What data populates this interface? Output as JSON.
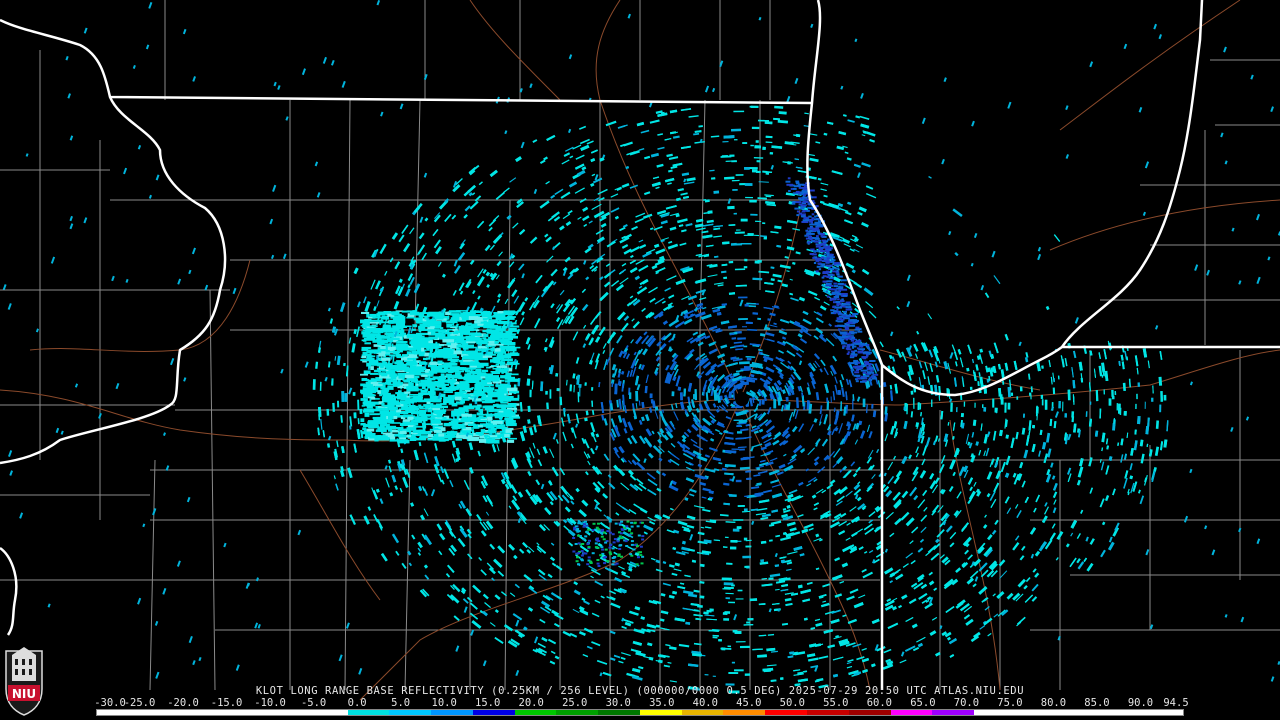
{
  "product": {
    "caption": "KLOT LONG RANGE BASE REFLECTIVITY (0.25KM / 256 LEVEL) (000000/0000 0.5 DEG) 2025-07-29 20:50 UTC  ATLAS.NIU.EDU",
    "station": "KLOT",
    "timestamp": "2025-07-29 20:50 UTC",
    "source": "ATLAS.NIU.EDU"
  },
  "logo": {
    "icon": "niu-logo-icon",
    "text": "NIU",
    "color": "#c8102e"
  },
  "color_scale": {
    "labels": [
      "-30.0",
      "-25.0",
      "-20.0",
      "-15.0",
      "-10.0",
      "-5.0",
      "0.0",
      "5.0",
      "10.0",
      "15.0",
      "20.0",
      "25.0",
      "30.0",
      "35.0",
      "40.0",
      "45.0",
      "50.0",
      "55.0",
      "60.0",
      "65.0",
      "70.0",
      "75.0",
      "80.0",
      "85.0",
      "90.0",
      "94.5"
    ],
    "colors": [
      "#ffffff",
      "#ffffff",
      "#ffffff",
      "#ffffff",
      "#ffffff",
      "#ffffff",
      "#00e0e0",
      "#00c8ff",
      "#0096ff",
      "#0000e6",
      "#00c800",
      "#00a000",
      "#007800",
      "#ffff00",
      "#e6b400",
      "#ff8c00",
      "#ff0000",
      "#c80000",
      "#a00000",
      "#ff00ff",
      "#a000ff",
      "#ffffff",
      "#ffffff",
      "#ffffff",
      "#ffffff",
      "#ffffff"
    ]
  },
  "map_colors": {
    "background": "#000000",
    "state_border": "#ffffff",
    "county_border": "#8a8a8a",
    "highway": "#8b4a2b",
    "radar_echo": [
      "#00e6e6",
      "#00b4dc",
      "#0a64d2",
      "#1e3cc8",
      "#00c850"
    ]
  }
}
